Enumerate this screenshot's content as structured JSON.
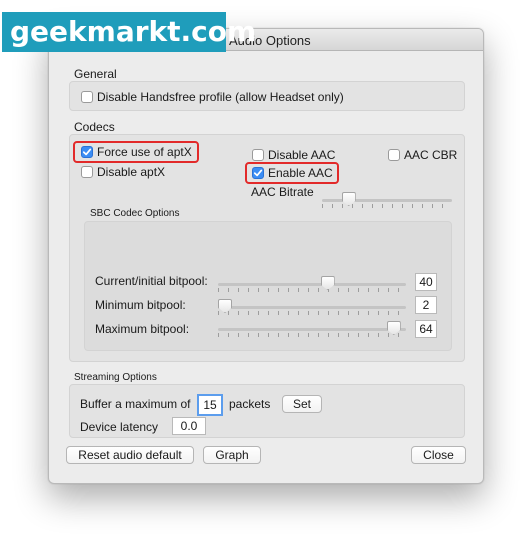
{
  "watermark": {
    "text": "geekmarkt.com"
  },
  "window": {
    "title": "Audio Options"
  },
  "general": {
    "label": "General",
    "disable_handsfree": {
      "label": "Disable Handsfree profile (allow Headset only)",
      "checked": false
    }
  },
  "codecs": {
    "label": "Codecs",
    "force_aptx": {
      "label": "Force use of aptX",
      "checked": true
    },
    "disable_aptx": {
      "label": "Disable aptX",
      "checked": false
    },
    "disable_aac": {
      "label": "Disable AAC",
      "checked": false
    },
    "enable_aac": {
      "label": "Enable AAC",
      "checked": true
    },
    "aac_cbr": {
      "label": "AAC CBR",
      "checked": false
    },
    "aac_bitrate": {
      "label": "AAC Bitrate",
      "level": 0.17
    },
    "sbc": {
      "label": "SBC Codec Options",
      "current_bitpool": {
        "label": "Current/initial bitpool:",
        "value": "40",
        "level": 0.59
      },
      "minimum_bitpool": {
        "label": "Minimum bitpool:",
        "value": "2",
        "level": 0.0
      },
      "maximum_bitpool": {
        "label": "Maximum bitpool:",
        "value": "64",
        "level": 0.97
      }
    }
  },
  "streaming": {
    "label": "Streaming Options",
    "buffer_label": "Buffer a maximum of",
    "buffer_value": "15",
    "packets_label": "packets",
    "set_button": "Set",
    "latency_label": "Device latency",
    "latency_value": "0.0"
  },
  "buttons": {
    "reset": "Reset audio default",
    "graph": "Graph",
    "close": "Close"
  }
}
